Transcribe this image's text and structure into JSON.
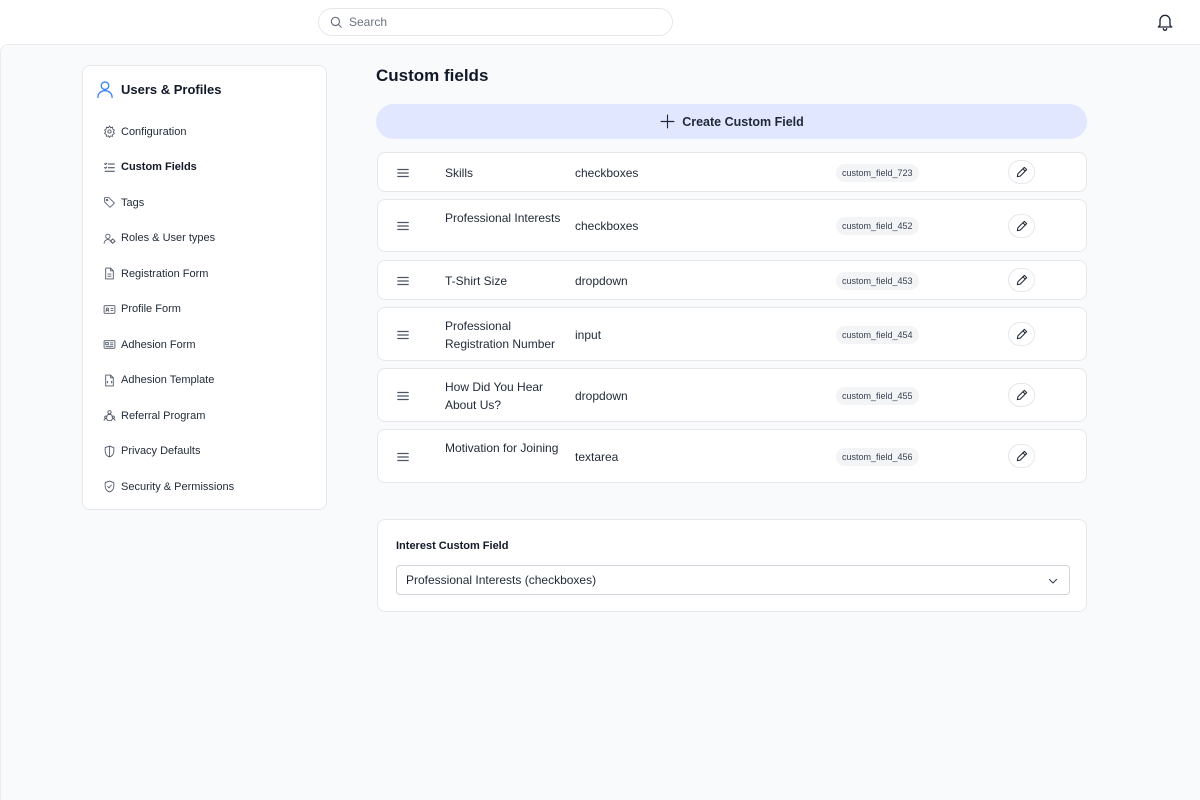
{
  "header": {
    "search_placeholder": "Search"
  },
  "sidebar": {
    "title": "Users & Profiles",
    "items": [
      {
        "label": "Configuration",
        "icon": "gear-icon"
      },
      {
        "label": "Custom Fields",
        "icon": "list-check-icon",
        "active": true
      },
      {
        "label": "Tags",
        "icon": "tag-icon"
      },
      {
        "label": "Roles & User types",
        "icon": "user-roles-icon"
      },
      {
        "label": "Registration Form",
        "icon": "document-icon"
      },
      {
        "label": "Profile Form",
        "icon": "id-card-icon"
      },
      {
        "label": "Adhesion Form",
        "icon": "form-card-icon"
      },
      {
        "label": "Adhesion Template",
        "icon": "template-file-icon"
      },
      {
        "label": "Referral Program",
        "icon": "referral-icon"
      },
      {
        "label": "Privacy Defaults",
        "icon": "shield-icon"
      },
      {
        "label": "Security & Permissions",
        "icon": "shield-check-icon"
      }
    ]
  },
  "main": {
    "title": "Custom fields",
    "create_button_label": "Create Custom Field",
    "fields": [
      {
        "name": "Skills",
        "type": "checkboxes",
        "key": "custom_field_723"
      },
      {
        "name": "Professional Interests",
        "type": "checkboxes",
        "key": "custom_field_452"
      },
      {
        "name": "T-Shirt Size",
        "type": "dropdown",
        "key": "custom_field_453"
      },
      {
        "name": "Professional Registration Number",
        "type": "input",
        "key": "custom_field_454"
      },
      {
        "name": "How Did You Hear About Us?",
        "type": "dropdown",
        "key": "custom_field_455"
      },
      {
        "name": "Motivation for Joining",
        "type": "textarea",
        "key": "custom_field_456"
      }
    ],
    "interest": {
      "label": "Interest Custom Field",
      "selected": "Professional Interests (checkboxes)"
    }
  },
  "colors": {
    "accent_light": "#e0e7ff",
    "user_icon": "#3b82f6",
    "background": "#f9fafb"
  }
}
